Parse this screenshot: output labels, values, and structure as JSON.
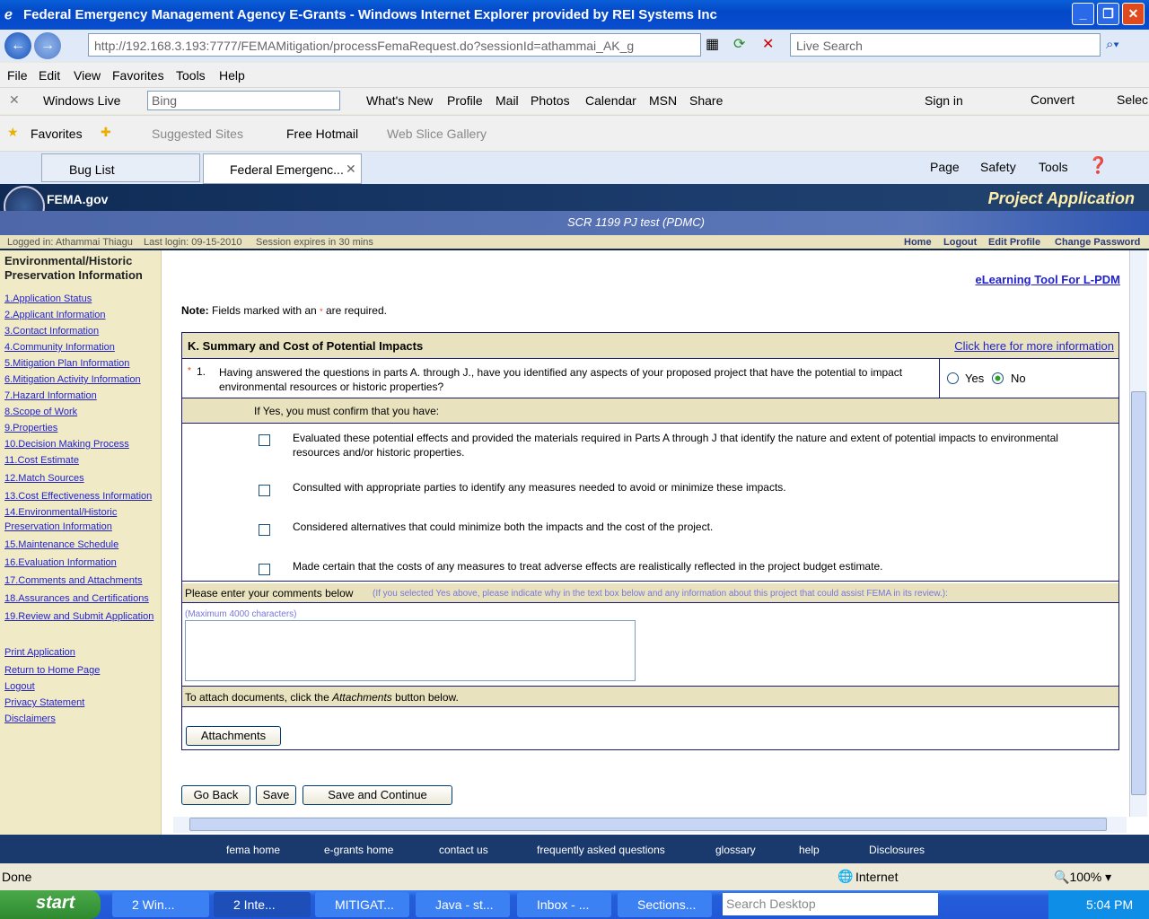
{
  "window": {
    "title": "Federal Emergency Management Agency E-Grants - Windows Internet Explorer provided by REI Systems Inc"
  },
  "address": {
    "url": "http://192.168.3.193:7777/FEMAMitigation/processFemaRequest.do?sessionId=athammai_AK_g",
    "search_placeholder": "Live Search"
  },
  "menu": [
    "File",
    "Edit",
    "View",
    "Favorites",
    "Tools",
    "Help"
  ],
  "live_toolbar": {
    "brand": "Windows Live",
    "search_placeholder": "Bing",
    "links": [
      "What's New",
      "Profile",
      "Mail",
      "Photos",
      "Calendar",
      "MSN",
      "Share"
    ],
    "sign_in": "Sign in",
    "convert": "Convert",
    "select": "Selec"
  },
  "favorites": {
    "label": "Favorites",
    "items": [
      "Suggested Sites",
      "Free Hotmail",
      "Web Slice Gallery"
    ]
  },
  "tabs": [
    {
      "label": "Bug List"
    },
    {
      "label": "Federal Emergenc..."
    }
  ],
  "command_bar": [
    "Page",
    "Safety",
    "Tools"
  ],
  "header": {
    "logo": "FEMA.gov",
    "title": "Project Application",
    "subtitle": "SCR 1199 PJ test (PDMC)",
    "logged_in": "Logged in: Athammai Thiagu",
    "last_login": "Last login: 09-15-2010",
    "session": "Session expires in 30 mins",
    "links": [
      "Home",
      "Logout",
      "Edit Profile",
      "Change Password"
    ]
  },
  "sidebar": {
    "heading": "Environmental/Historic Preservation Information",
    "items": [
      "1.Application Status",
      "2.Applicant Information",
      "3.Contact Information",
      "4.Community Information",
      "5.Mitigation Plan Information",
      "6.Mitigation Activity Information",
      "7.Hazard Information",
      "8.Scope of Work",
      "9.Properties",
      "10.Decision Making Process",
      "11.Cost Estimate",
      "12.Match Sources",
      "13.Cost Effectiveness Information",
      "14.Environmental/Historic Preservation Information",
      "15.Maintenance Schedule",
      "16.Evaluation Information",
      "17.Comments and Attachments",
      "18.Assurances and Certifications",
      "19.Review and Submit Application"
    ],
    "extra": [
      "Print Application",
      "Return to Home Page",
      "Logout",
      "Privacy Statement",
      "Disclaimers"
    ]
  },
  "main": {
    "elearning": "eLearning Tool For L-PDM",
    "note_label": "Note:",
    "note_text": "Fields marked with an",
    "note_star": "*",
    "note_end": "are required.",
    "section_title": "K. Summary and Cost of Potential Impacts",
    "more_info": "Click here for more information",
    "q1_star": "*",
    "q1_num": "1.",
    "q1_text": "Having answered the questions in parts A. through J., have you identified any aspects of your proposed project that have the potential to impact environmental resources or historic properties?",
    "yes": "Yes",
    "no": "No",
    "selected": "No",
    "if_yes": "If Yes, you must confirm that you have:",
    "checks": [
      "Evaluated these potential effects and provided the materials required in Parts A through J that identify the nature and extent of potential impacts to environmental resources and/or historic properties.",
      "Consulted with appropriate parties to identify any measures needed to avoid or minimize these impacts.",
      "Considered alternatives that could minimize both the impacts and the cost of the project.",
      "Made certain that the costs of any measures to treat adverse effects are realistically reflected in the project budget estimate."
    ],
    "comments_label": "Please enter your comments below",
    "comments_hint": "(If you selected Yes above, please indicate why in the text box below and any information about this project that could assist FEMA in its review.):",
    "max_chars": "(Maximum 4000 characters)",
    "comments_value": "",
    "attach_pre": "To attach documents, click the",
    "attach_em": "Attachments",
    "attach_post": "button below.",
    "attach_btn": "Attachments",
    "buttons": [
      "Go Back",
      "Save",
      "Save and Continue"
    ]
  },
  "footer": [
    "fema home",
    "e-grants home",
    "contact us",
    "frequently asked questions",
    "glossary",
    "help",
    "Disclosures"
  ],
  "status": {
    "text": "Done",
    "zone": "Internet",
    "zoom": "100%"
  },
  "taskbar": {
    "start": "start",
    "tasks": [
      "2 Win...",
      "2 Inte...",
      "MITIGAT...",
      "Java - st...",
      "Inbox - ...",
      "Sections..."
    ],
    "search_placeholder": "Search Desktop",
    "clock": "5:04 PM"
  },
  "colors": {
    "link": "#2222cc",
    "header_dark": "#13294b",
    "beige": "#e9e2be",
    "required": "#ff3300"
  }
}
